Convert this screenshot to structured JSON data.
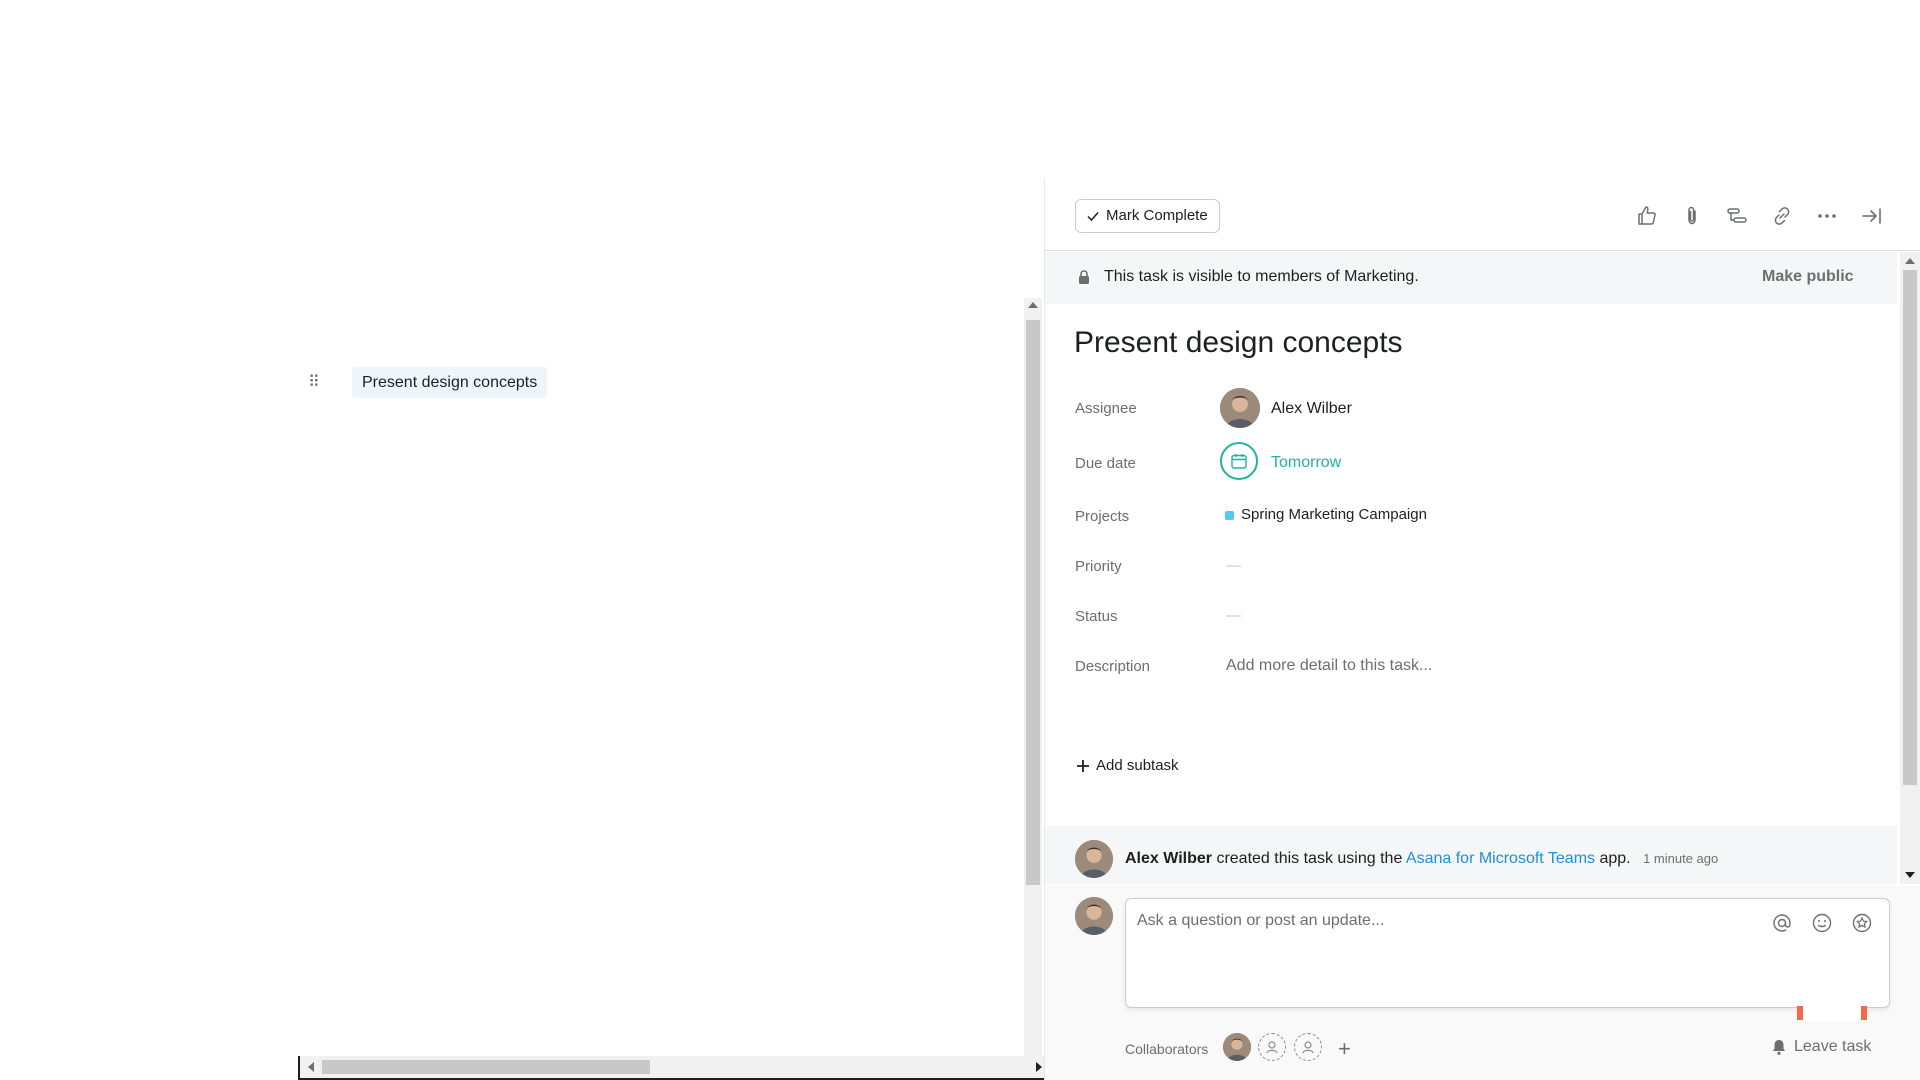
{
  "list": {
    "task_name": "Present design concepts"
  },
  "task": {
    "mark_complete_label": "Mark Complete",
    "visibility_text": "This task is visible to members of Marketing.",
    "make_public_label": "Make public",
    "title": "Present design concepts",
    "fields": {
      "assignee_label": "Assignee",
      "assignee_value": "Alex Wilber",
      "due_label": "Due date",
      "due_value": "Tomorrow",
      "projects_label": "Projects",
      "project_value": "Spring Marketing Campaign",
      "priority_label": "Priority",
      "priority_value": "—",
      "status_label": "Status",
      "status_value": "—",
      "description_label": "Description",
      "description_placeholder": "Add more detail to this task..."
    },
    "add_subtask_label": "Add subtask",
    "activity": {
      "actor": "Alex Wilber",
      "text_before_link": "created this task using the",
      "link_text": "Asana for Microsoft Teams",
      "text_after_link": "app.",
      "time": "1 minute ago"
    },
    "comment_placeholder": "Ask a question or post an update...",
    "collaborators_label": "Collaborators",
    "leave_task_label": "Leave task"
  },
  "toolbar_icons": [
    "thumbs-up-icon",
    "paperclip-icon",
    "subtask-icon",
    "link-icon",
    "more-icon",
    "close-pane-icon"
  ],
  "colors": {
    "accent_teal": "#1fb3a0",
    "link_blue": "#1f8fd6",
    "project_color": "#4ecbf1"
  }
}
